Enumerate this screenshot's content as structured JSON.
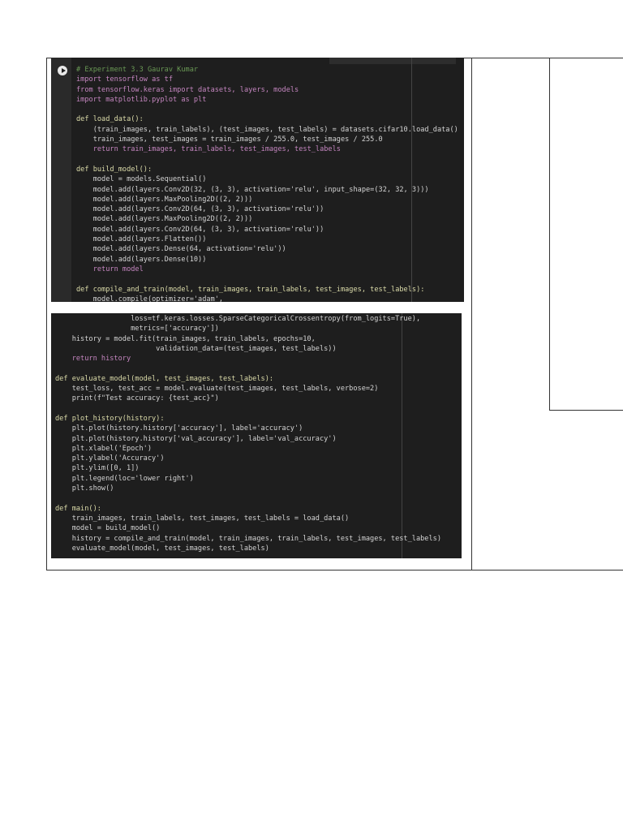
{
  "cell1": {
    "lines": [
      "# Experiment 3.3 Gaurav Kumar",
      "import tensorflow as tf",
      "from tensorflow.keras import datasets, layers, models",
      "import matplotlib.pyplot as plt",
      "",
      "def load_data():",
      "    (train_images, train_labels), (test_images, test_labels) = datasets.cifar10.load_data()",
      "    train_images, test_images = train_images / 255.0, test_images / 255.0",
      "    return train_images, train_labels, test_images, test_labels",
      "",
      "def build_model():",
      "    model = models.Sequential()",
      "    model.add(layers.Conv2D(32, (3, 3), activation='relu', input_shape=(32, 32, 3)))",
      "    model.add(layers.MaxPooling2D((2, 2)))",
      "    model.add(layers.Conv2D(64, (3, 3), activation='relu'))",
      "    model.add(layers.MaxPooling2D((2, 2)))",
      "    model.add(layers.Conv2D(64, (3, 3), activation='relu'))",
      "    model.add(layers.Flatten())",
      "    model.add(layers.Dense(64, activation='relu'))",
      "    model.add(layers.Dense(10))",
      "    return model",
      "",
      "def compile_and_train(model, train_images, train_labels, test_images, test_labels):",
      "    model.compile(optimizer='adam',"
    ]
  },
  "cell2": {
    "lines": [
      "                  loss=tf.keras.losses.SparseCategoricalCrossentropy(from_logits=True),",
      "                  metrics=['accuracy'])",
      "    history = model.fit(train_images, train_labels, epochs=10,",
      "                        validation_data=(test_images, test_labels))",
      "    return history",
      "",
      "def evaluate_model(model, test_images, test_labels):",
      "    test_loss, test_acc = model.evaluate(test_images, test_labels, verbose=2)",
      "    print(f\"Test accuracy: {test_acc}\")",
      "",
      "def plot_history(history):",
      "    plt.plot(history.history['accuracy'], label='accuracy')",
      "    plt.plot(history.history['val_accuracy'], label='val_accuracy')",
      "    plt.xlabel('Epoch')",
      "    plt.ylabel('Accuracy')",
      "    plt.ylim([0, 1])",
      "    plt.legend(loc='lower right')",
      "    plt.show()",
      "",
      "def main():",
      "    train_images, train_labels, test_images, test_labels = load_data()",
      "    model = build_model()",
      "    history = compile_and_train(model, train_images, train_labels, test_images, test_labels)",
      "    evaluate_model(model, test_images, test_labels)"
    ]
  }
}
